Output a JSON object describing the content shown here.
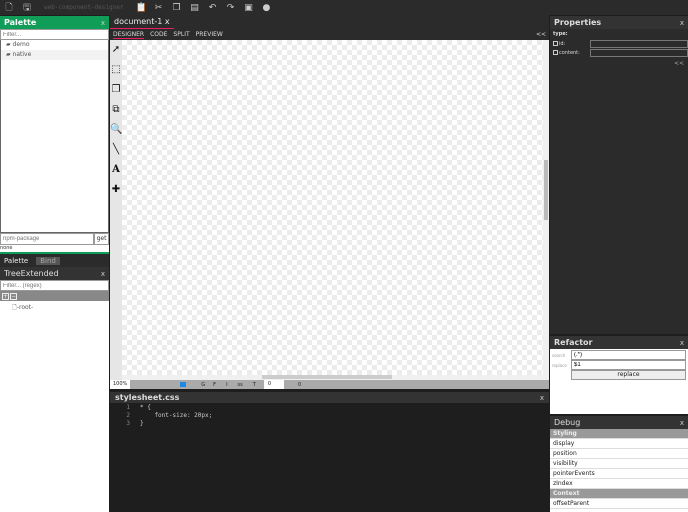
{
  "toolbar": {
    "title": "web-component-designer",
    "icons": [
      "new-file-icon",
      "save-icon",
      "clipboard-icon",
      "cut-icon",
      "copy-icon",
      "paste-icon",
      "undo-icon",
      "redo-icon",
      "preview-icon",
      "github-icon"
    ]
  },
  "palette": {
    "title": "Palette",
    "close": "x",
    "filter_placeholder": "Filter...",
    "items": [
      "demo",
      "native"
    ],
    "npm_placeholder": "npm-package",
    "get_label": "get",
    "status": "none",
    "tabs": [
      "Palette",
      "Bind"
    ]
  },
  "tree": {
    "title": "TreeExtended",
    "close": "x",
    "filter_placeholder": "Filter... (regex)",
    "root": "-root-"
  },
  "document": {
    "tab": "document-1",
    "tab_close": "x",
    "modes": [
      "DESIGNER",
      "CODE",
      "SPLIT",
      "PREVIEW"
    ],
    "collapse": "<<",
    "zoom": "100%",
    "status_items": [
      "G",
      "F",
      "I",
      "ss",
      "T"
    ],
    "value1": "0",
    "value2": "0"
  },
  "stylesheet": {
    "title": "stylesheet.css",
    "close": "x",
    "lines": [
      {
        "n": "1",
        "t": "* {"
      },
      {
        "n": "2",
        "t": "    font-size: 20px;"
      },
      {
        "n": "3",
        "t": "}"
      }
    ]
  },
  "properties": {
    "title": "Properties",
    "close": "x",
    "type_label": "type:",
    "id_label": "id:",
    "content_label": "content:",
    "collapse": "<<"
  },
  "refactor": {
    "title": "Refactor",
    "close": "x",
    "search_label": "search",
    "search_value": "(.*)",
    "replace_label": "replace",
    "replace_value": "$1",
    "replace_button": "replace"
  },
  "debug": {
    "title": "Debug",
    "close": "x",
    "rows": [
      {
        "label": "Styling",
        "section": true
      },
      {
        "label": "display"
      },
      {
        "label": "position"
      },
      {
        "label": "visibility"
      },
      {
        "label": "pointerEvents"
      },
      {
        "label": "zIndex"
      },
      {
        "label": "Context",
        "section": true
      },
      {
        "label": "offsetParent"
      }
    ]
  },
  "colors": {
    "palette_header": "#0f9d58",
    "accent": "#e91e63"
  }
}
